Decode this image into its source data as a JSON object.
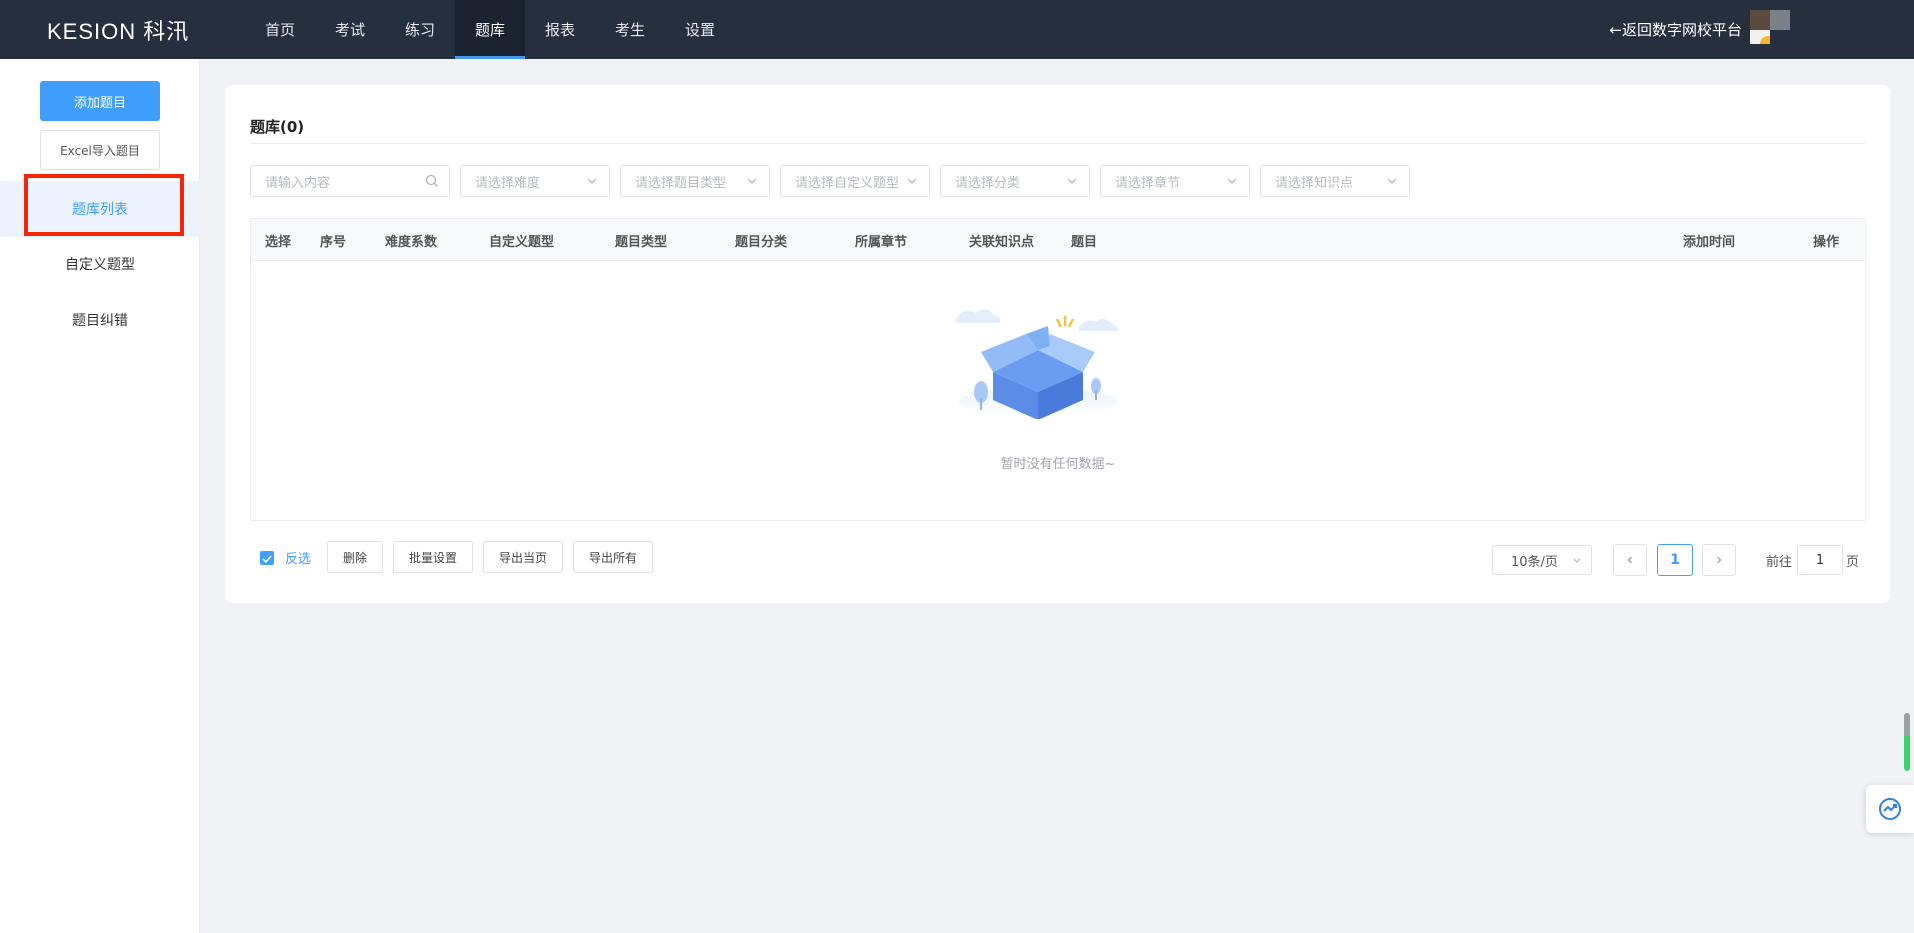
{
  "app": {
    "logo_text": "KESION 科汛",
    "back_link": "←返回数字网校平台"
  },
  "nav": {
    "items": [
      "首页",
      "考试",
      "练习",
      "题库",
      "报表",
      "考生",
      "设置"
    ],
    "active": "题库"
  },
  "sidebar": {
    "add_button": "添加题目",
    "import_button": "Excel导入题目",
    "items": [
      "题库列表",
      "自定义题型",
      "题目纠错"
    ],
    "active": "题库列表"
  },
  "main": {
    "title": "题库(0)",
    "filters": {
      "search_placeholder": "请输入内容",
      "difficulty": "请选择难度",
      "question_type": "请选择题目类型",
      "custom_type": "请选择自定义题型",
      "category": "请选择分类",
      "chapter": "请选择章节",
      "knowledge": "请选择知识点"
    },
    "table": {
      "columns": [
        "选择",
        "序号",
        "难度系数",
        "自定义题型",
        "题目类型",
        "题目分类",
        "所属章节",
        "关联知识点",
        "题目",
        "添加时间",
        "操作"
      ],
      "rows": [],
      "empty_text": "暂时没有任何数据~"
    },
    "bottom": {
      "invert_label": "反选",
      "delete": "删除",
      "batch_settings": "批量设置",
      "export_page": "导出当页",
      "export_all": "导出所有"
    },
    "pagination": {
      "page_size": "10条/页",
      "current_page": "1",
      "goto_label": "前往",
      "goto_value": "1",
      "page_unit": "页"
    }
  },
  "colors": {
    "topbar": "#262f3d",
    "accent": "#409eff",
    "highlight": "#f5250a"
  }
}
